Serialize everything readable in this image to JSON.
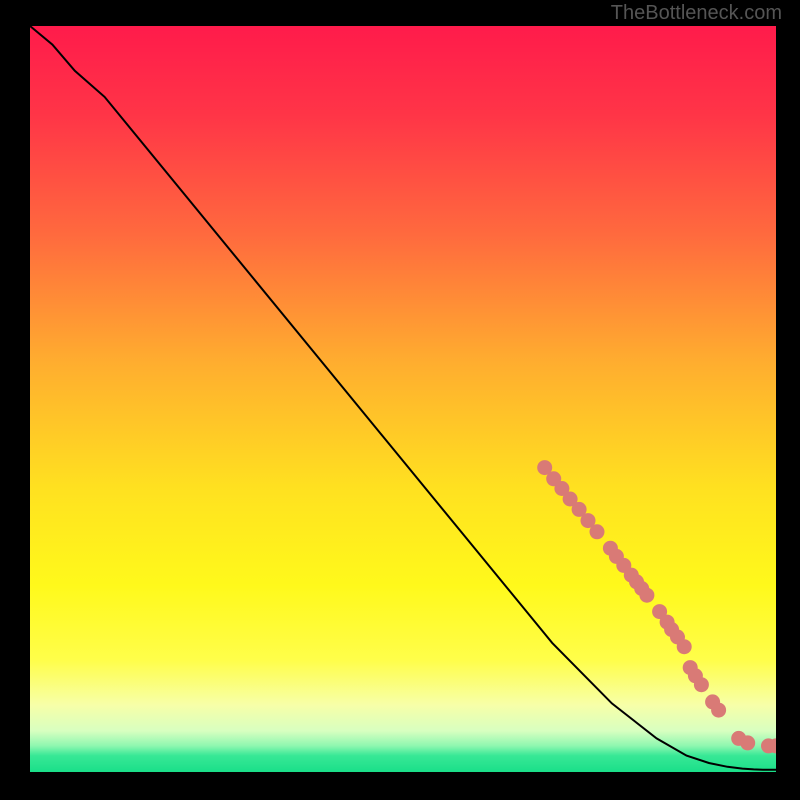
{
  "watermark": "TheBottleneck.com",
  "colors": {
    "background": "#000000",
    "watermark": "#555555",
    "curve": "#000000",
    "dots": "#d97a76",
    "gradient_stops": [
      {
        "offset": 0.0,
        "color": "#ff1b4b"
      },
      {
        "offset": 0.12,
        "color": "#ff3547"
      },
      {
        "offset": 0.28,
        "color": "#ff6a3e"
      },
      {
        "offset": 0.45,
        "color": "#ffad2f"
      },
      {
        "offset": 0.62,
        "color": "#ffe120"
      },
      {
        "offset": 0.75,
        "color": "#fff91b"
      },
      {
        "offset": 0.85,
        "color": "#fffe4a"
      },
      {
        "offset": 0.91,
        "color": "#f7ffa8"
      },
      {
        "offset": 0.945,
        "color": "#d8ffc0"
      },
      {
        "offset": 0.965,
        "color": "#8ef7b0"
      },
      {
        "offset": 0.978,
        "color": "#38e896"
      },
      {
        "offset": 1.0,
        "color": "#1adf89"
      }
    ]
  },
  "chart_data": {
    "type": "line",
    "title": "",
    "xlabel": "",
    "ylabel": "",
    "xlim": [
      0,
      100
    ],
    "ylim": [
      0,
      100
    ],
    "series": [
      {
        "name": "curve",
        "x": [
          0,
          3,
          6,
          10,
          20,
          30,
          40,
          50,
          60,
          70,
          78,
          84,
          88,
          91,
          93.5,
          95.5,
          97,
          98.5,
          100
        ],
        "y": [
          100,
          97.5,
          94,
          90.5,
          78.3,
          66.1,
          53.9,
          41.7,
          29.5,
          17.3,
          9.2,
          4.5,
          2.2,
          1.2,
          0.7,
          0.45,
          0.35,
          0.3,
          0.3
        ]
      }
    ],
    "scatter": {
      "name": "dots",
      "points": [
        {
          "x": 69.0,
          "y": 40.8
        },
        {
          "x": 70.2,
          "y": 39.3
        },
        {
          "x": 71.3,
          "y": 38.0
        },
        {
          "x": 72.4,
          "y": 36.6
        },
        {
          "x": 73.6,
          "y": 35.2
        },
        {
          "x": 74.8,
          "y": 33.7
        },
        {
          "x": 76.0,
          "y": 32.2
        },
        {
          "x": 77.8,
          "y": 30.0
        },
        {
          "x": 78.6,
          "y": 28.9
        },
        {
          "x": 79.6,
          "y": 27.7
        },
        {
          "x": 80.6,
          "y": 26.4
        },
        {
          "x": 81.3,
          "y": 25.5
        },
        {
          "x": 82.0,
          "y": 24.6
        },
        {
          "x": 82.7,
          "y": 23.7
        },
        {
          "x": 84.4,
          "y": 21.5
        },
        {
          "x": 85.4,
          "y": 20.1
        },
        {
          "x": 86.0,
          "y": 19.1
        },
        {
          "x": 86.8,
          "y": 18.1
        },
        {
          "x": 87.7,
          "y": 16.8
        },
        {
          "x": 88.5,
          "y": 14.0
        },
        {
          "x": 89.2,
          "y": 12.9
        },
        {
          "x": 90.0,
          "y": 11.7
        },
        {
          "x": 91.5,
          "y": 9.4
        },
        {
          "x": 92.3,
          "y": 8.3
        },
        {
          "x": 95.0,
          "y": 4.5
        },
        {
          "x": 96.2,
          "y": 3.9
        },
        {
          "x": 99.0,
          "y": 3.5
        },
        {
          "x": 100.0,
          "y": 3.5
        }
      ]
    }
  }
}
